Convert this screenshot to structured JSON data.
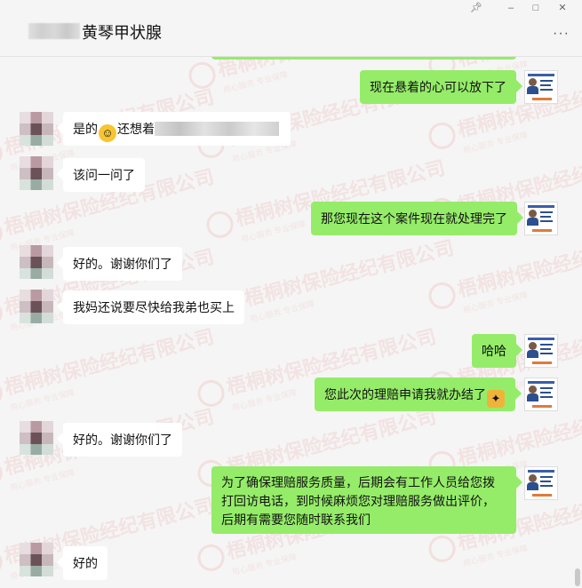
{
  "header": {
    "title": "黄琴甲状腺",
    "more_label": "···",
    "window_controls": [
      "pin",
      "minimize",
      "maximize",
      "close"
    ]
  },
  "watermark": {
    "text": "梧桐树保险经纪有限公司",
    "subtext": "用心服务 专业保障"
  },
  "messages": [
    {
      "side": "out",
      "text": "现在悬着的心可以放下了"
    },
    {
      "side": "in",
      "prefix": "是的",
      "emoji": "grinning",
      "suffix": "还想着"
    },
    {
      "side": "in",
      "text": "该问一问了"
    },
    {
      "side": "out",
      "text": "那您现在这个案件现在就处理完了"
    },
    {
      "side": "in",
      "text": "好的。谢谢你们了"
    },
    {
      "side": "in",
      "text": "我妈还说要尽快给我弟也买上"
    },
    {
      "side": "out",
      "text": "哈哈"
    },
    {
      "side": "out",
      "text": "您此次的理赔申请我就办结了",
      "emoji": "handshake"
    },
    {
      "side": "in",
      "text": "好的。谢谢你们了"
    },
    {
      "side": "out",
      "text": "为了确保理赔服务质量，后期会有工作人员给您拨打回访电话，到时候麻烦您对理赔服务做出评价，后期有需要您随时联系我们"
    },
    {
      "side": "in",
      "text": "好的"
    }
  ]
}
